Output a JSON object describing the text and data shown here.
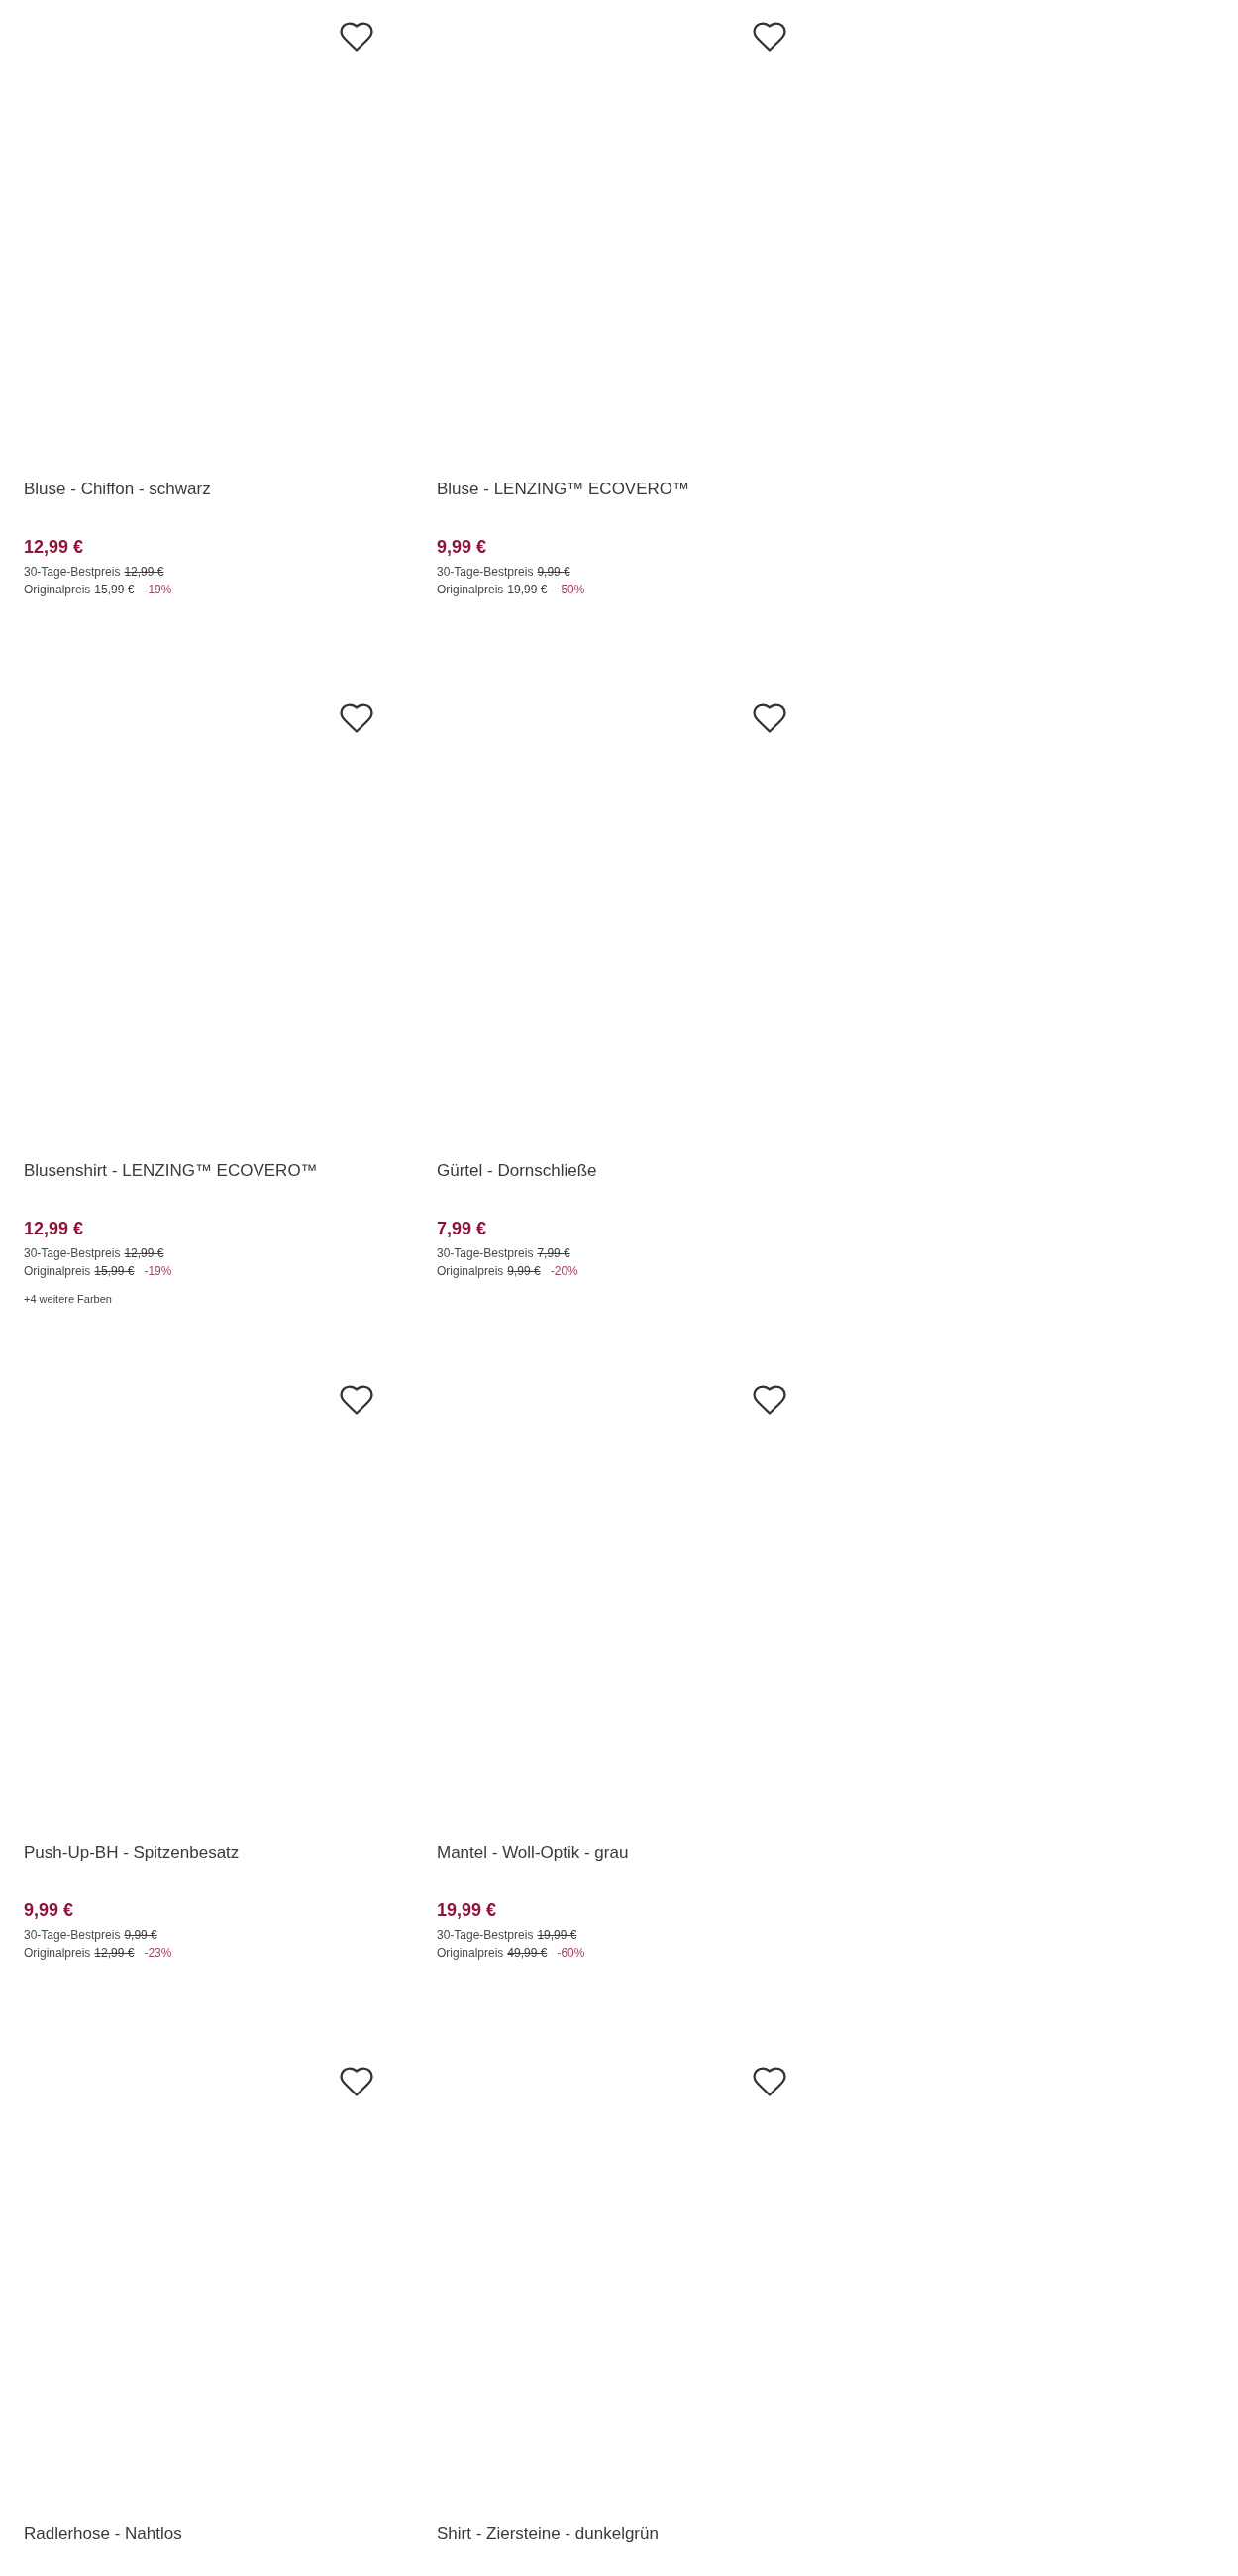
{
  "products": [
    {
      "title": "Bluse - Chiffon - schwarz",
      "wishlisted": false,
      "price": "12,99 €",
      "best_price_label": "30-Tage-Bestpreis",
      "best_price": "12,99 €",
      "original_label": "Originalpreis",
      "original_price": "15,99 €",
      "discount": "-19%"
    },
    {
      "title": "Bluse - LENZING™ ECOVERO™",
      "wishlisted": false,
      "price": "9,99 €",
      "best_price_label": "30-Tage-Bestpreis",
      "best_price": "9,99 €",
      "original_label": "Originalpreis",
      "original_price": "19,99 €",
      "discount": "-50%"
    },
    {
      "title": "Blusenshirt - LENZING™ ECOVERO™",
      "wishlisted": false,
      "price": "12,99 €",
      "best_price_label": "30-Tage-Bestpreis",
      "best_price": "12,99 €",
      "original_label": "Originalpreis",
      "original_price": "15,99 €",
      "discount": "-19%",
      "more_colors": "+4 weitere Farben"
    },
    {
      "title": "Gürtel - Dornschließe",
      "wishlisted": false,
      "price": "7,99 €",
      "best_price_label": "30-Tage-Bestpreis",
      "best_price": "7,99 €",
      "original_label": "Originalpreis",
      "original_price": "9,99 €",
      "discount": "-20%"
    },
    {
      "title": "Push-Up-BH - Spitzenbesatz",
      "wishlisted": false,
      "price": "9,99 €",
      "best_price_label": "30-Tage-Bestpreis",
      "best_price": "9,99 €",
      "original_label": "Originalpreis",
      "original_price": "12,99 €",
      "discount": "-23%"
    },
    {
      "title": "Mantel - Woll-Optik - grau",
      "wishlisted": false,
      "price": "19,99 €",
      "best_price_label": "30-Tage-Bestpreis",
      "best_price": "19,99 €",
      "original_label": "Originalpreis",
      "original_price": "49,99 €",
      "discount": "-60%"
    },
    {
      "title": "Radlerhose - Nahtlos",
      "wishlisted": false
    },
    {
      "title": "Shirt - Ziersteine - dunkelgrün",
      "wishlisted": false
    }
  ]
}
